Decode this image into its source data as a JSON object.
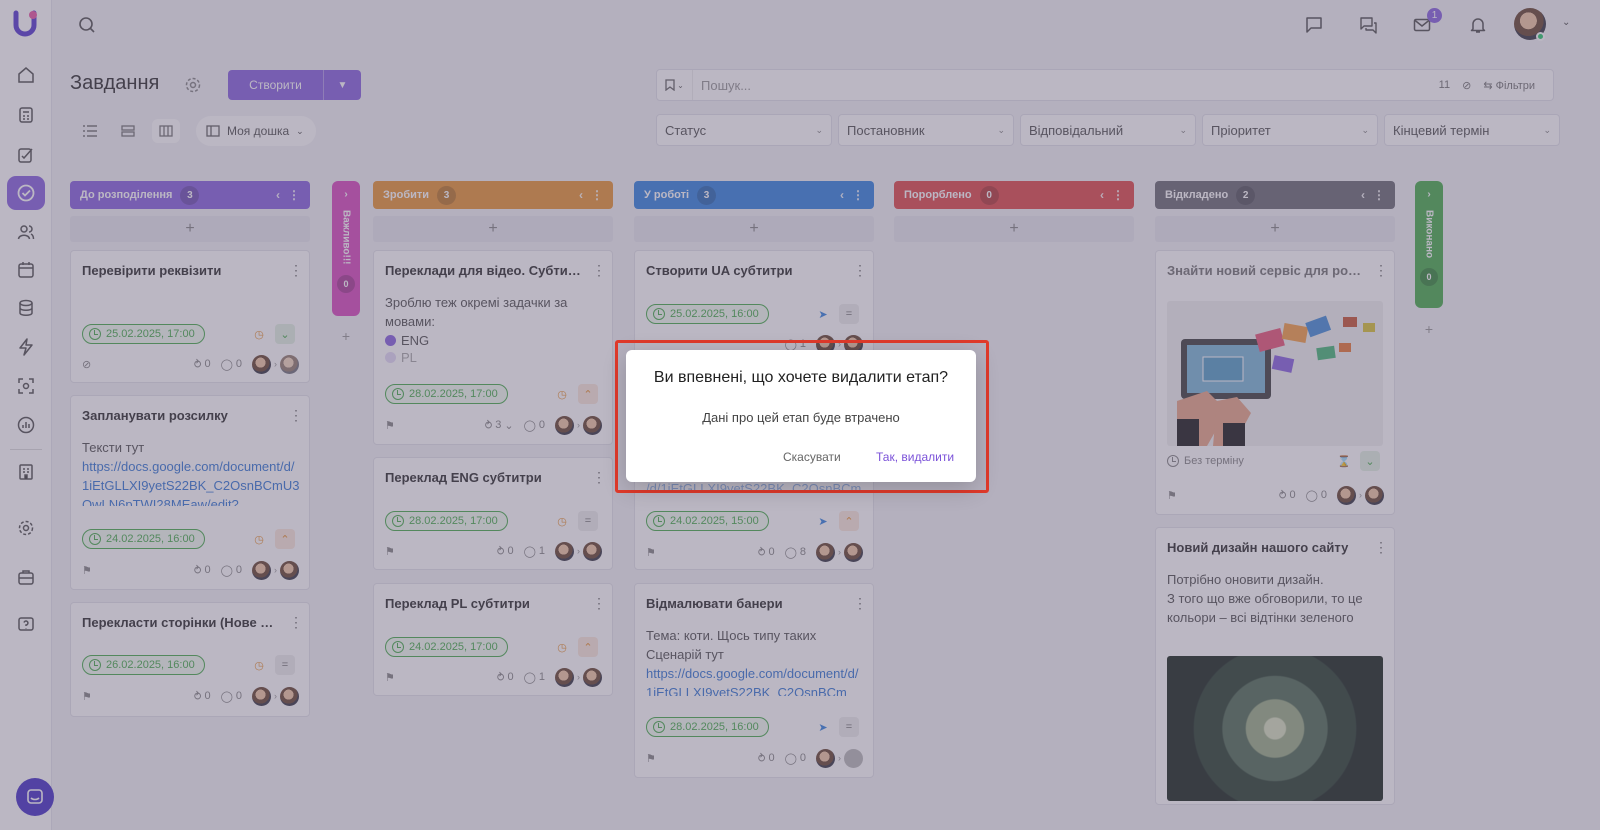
{
  "page": {
    "title": "Завдання",
    "create_label": "Створити"
  },
  "topbar": {
    "search_placeholder": "",
    "mail_badge": "1"
  },
  "view": {
    "board_select": "Моя дошка"
  },
  "search": {
    "placeholder": "Пошук...",
    "count": "11",
    "filters_label": "Фільтри"
  },
  "filters": [
    "Статус",
    "Постановник",
    "Відповідальний",
    "Пріоритет",
    "Кінцевий термін"
  ],
  "columns": [
    {
      "name": "До розподілення",
      "count": "3",
      "color": "#8b66e0"
    },
    {
      "name": "Зробити",
      "count": "3",
      "color": "#e8963a"
    },
    {
      "name": "У роботі",
      "count": "3",
      "color": "#3a86e0"
    },
    {
      "name": "Порорблено",
      "count": "0",
      "color": "#e04e4e"
    },
    {
      "name": "Відкладено",
      "count": "2",
      "color": "#6e6e78"
    }
  ],
  "vertical_columns": [
    {
      "name": "Важливо!!!",
      "count": "0",
      "color": "#d94fc0"
    },
    {
      "name": "Виконано",
      "count": "0",
      "color": "#4caf50"
    }
  ],
  "cards": {
    "c1": {
      "title": "Перевірити реквізити",
      "date": "25.02.2025, 17:00",
      "subtasks": "0",
      "comments": "0"
    },
    "c2": {
      "title": "Запланувати розсилку",
      "desc": "Тексти тут",
      "link": "https://docs.google.com/document/d/1iEtGLLXI9yetS22BK_C2OsnBCmU3OwLN6pTWI28MEaw/edit?",
      "date": "24.02.2025, 16:00",
      "subtasks": "0",
      "comments": "0"
    },
    "c3": {
      "title": "Перекласти сторінки (Нове …",
      "date": "26.02.2025, 16:00",
      "subtasks": "0",
      "comments": "0"
    },
    "c4": {
      "title": "Переклади для відео. Субти…",
      "desc": "Зроблю теж окремі задачки за мовами:",
      "lang1": "ENG",
      "lang2": "PL",
      "date": "28.02.2025, 17:00",
      "subtasks": "3",
      "comments": "0"
    },
    "c5": {
      "title": "Переклад ENG субтитри",
      "date": "28.02.2025, 17:00",
      "subtasks": "0",
      "comments": "1"
    },
    "c6": {
      "title": "Переклад PL субтитри",
      "date": "24.02.2025, 17:00",
      "subtasks": "0",
      "comments": "1"
    },
    "c7": {
      "title": "Створити UA субтитри",
      "date": "25.02.2025, 16:00",
      "comments": "1"
    },
    "c8": {
      "link": "/d/1iEtGLLXI9yetS22BK_C2OsnBCm",
      "date": "24.02.2025, 15:00",
      "subtasks": "0",
      "comments": "8"
    },
    "c9": {
      "title": "Відмалювати банери",
      "desc1": "Тема: коти. Щось типу таких",
      "desc2": "Сценарій тут",
      "link": "https://docs.google.com/document/d/1iEtGLLXI9yetS22BK_C2OsnBCm",
      "date": "28.02.2025, 16:00",
      "subtasks": "0",
      "comments": "0"
    },
    "c10": {
      "title": "Знайти новий сервіс для ро…",
      "date": "Без терміну",
      "subtasks": "0",
      "comments": "0"
    },
    "c11": {
      "title": "Новий дизайн нашого сайту",
      "desc": "Потрібно оновити дизайн.\nЗ того що вже обговорили, то це кольори – всі відтінки зеленого"
    }
  },
  "dialog": {
    "title": "Ви впевнені, що хочете видалити етап?",
    "text": "Дані про цей етап буде втрачено",
    "cancel": "Скасувати",
    "confirm": "Так, видалити"
  },
  "colors": {
    "accent": "#8b66e0",
    "danger_highlight": "#e03a2b",
    "date_green": "#4caf50"
  }
}
